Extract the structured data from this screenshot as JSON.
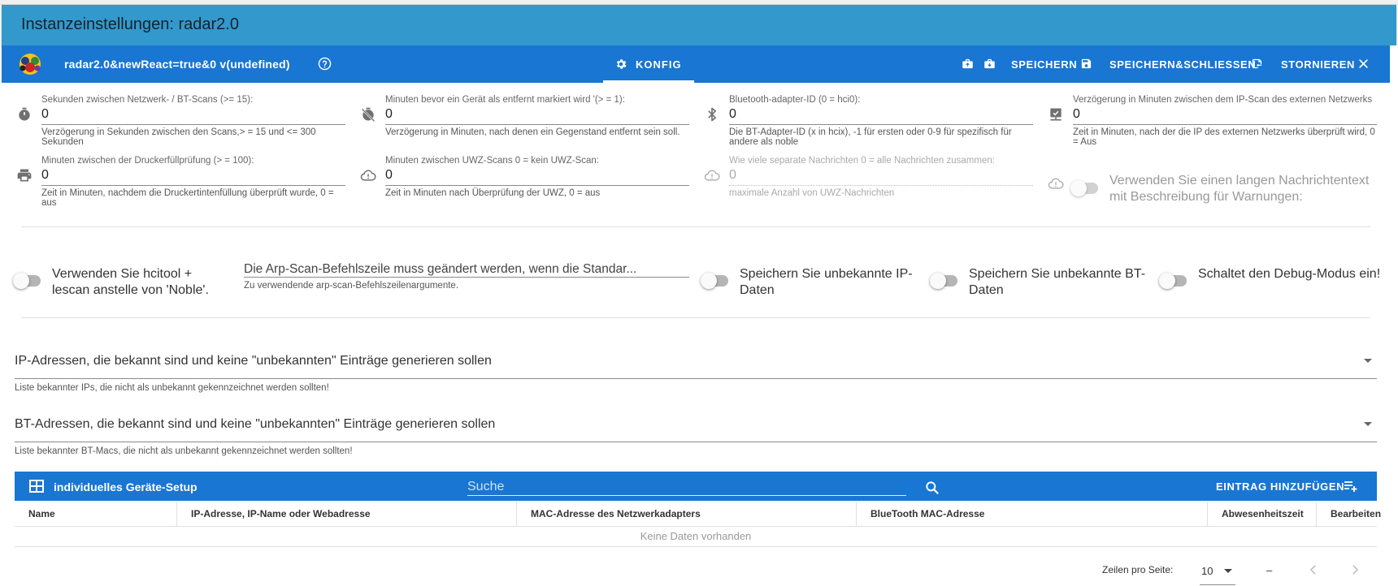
{
  "window": {
    "title": "Instanzeinstellungen: radar2.0"
  },
  "toolbar": {
    "adapter_title": "radar2.0&newReact=true&0 v(undefined)",
    "tab_label": "KONFIG",
    "save_label": "SPEICHERN",
    "save_close_label": "SPEICHERN&SCHLIESSEN",
    "cancel_label": "STORNIEREN"
  },
  "fields": {
    "scan_seconds": {
      "label": "Sekunden zwischen Netzwerk- / BT-Scans (>= 15):",
      "value": "0",
      "help": "Verzögerung in Sekunden zwischen den Scans,> = 15 und <= 300 Sekunden",
      "icon": "timer-icon"
    },
    "away_minutes": {
      "label": "Minuten bevor ein Gerät als entfernt markiert wird '(> = 1):",
      "value": "0",
      "help": "Verzögerung in Minuten, nach denen ein Gegenstand entfernt sein soll.",
      "icon": "timer-off-icon"
    },
    "bt_adapter": {
      "label": "Bluetooth-adapter-ID (0 = hci0):",
      "value": "0",
      "help": "Die BT-Adapter-ID (x in hcix), -1 für ersten oder 0-9 für spezifisch für andere als noble",
      "icon": "bluetooth-icon"
    },
    "ext_ip_delay": {
      "label": "Verzögerung in Minuten zwischen dem IP-Scan des externen Netzwerks",
      "value": "0",
      "help": "Zeit in Minuten, nach der die IP des externen Netzwerks überprüft wird, 0 = Aus",
      "icon": "network-icon"
    },
    "printer_minutes": {
      "label": "Minuten zwischen der Druckerfüllprüfung (> = 100):",
      "value": "0",
      "help": "Zeit in Minuten, nachdem die Druckertintenfüllung überprüft wurde, 0 = aus",
      "icon": "printer-icon"
    },
    "uwz_minutes": {
      "label": "Minuten zwischen UWZ-Scans 0 = kein UWZ-Scan:",
      "value": "0",
      "help": "Zeit in Minuten nach Überprüfung der UWZ, 0 = aus",
      "icon": "cloud-alert-icon"
    },
    "uwz_messages": {
      "label": "Wie viele separate Nachrichten 0 = alle Nachrichten zusammen:",
      "value": "0",
      "help": "maximale Anzahl von UWZ-Nachrichten",
      "icon": "cloud-alert-icon"
    },
    "long_text_switch": {
      "label": "Verwenden Sie einen langen Nachrichtentext mit Beschreibung für Warnungen:"
    }
  },
  "row2": {
    "hcitool_label": "Verwenden Sie hcitool + lescan anstelle von 'Noble'.",
    "arpscan": {
      "value": "Die Arp-Scan-Befehlszeile muss geändert werden, wenn die Standar...",
      "help": "Zu verwendende arp-scan-Befehlszeilenargumente."
    },
    "unknown_ip_label": "Speichern Sie unbekannte IP-Daten",
    "unknown_bt_label": "Speichern Sie unbekannte BT-Daten",
    "debug_label": "Schaltet den Debug-Modus ein!"
  },
  "selects": {
    "known_ips": {
      "label": "IP-Adressen, die bekannt sind und keine \"unbekannten\" Einträge generieren sollen",
      "help": "Liste bekannter IPs, die nicht als unbekannt gekennzeichnet werden sollten!"
    },
    "known_bts": {
      "label": "BT-Adressen, die bekannt sind und keine \"unbekannten\" Einträge generieren sollen",
      "help": "Liste bekannter BT-Macs, die nicht als unbekannt gekennzeichnet werden sollten!"
    }
  },
  "table": {
    "title": "individuelles Geräte-Setup",
    "search_placeholder": "Suche",
    "add_label": "EINTRAG HINZUFÜGEN",
    "columns": [
      "Name",
      "IP-Adresse, IP-Name oder Webadresse",
      "MAC-Adresse des Netzwerkadapters",
      "BlueTooth MAC-Adresse",
      "Abwesenheitszeit",
      "Bearbeiten"
    ],
    "empty_text": "Keine Daten vorhanden",
    "rows_per_page_label": "Zeilen pro Seite:",
    "rows_per_page": "10",
    "range": "–"
  },
  "colors": {
    "title_bar": "#3399cc",
    "toolbar": "#1976d2"
  }
}
